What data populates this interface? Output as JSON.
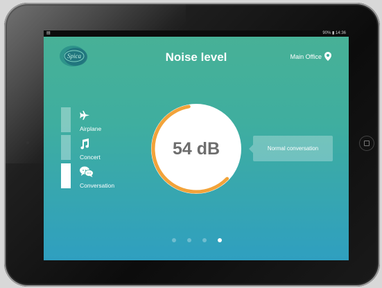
{
  "status_bar": {
    "right_text": "90% ▮ 14:36"
  },
  "header": {
    "title": "Noise level",
    "location": "Main Office",
    "logo_text": "Spica"
  },
  "categories": [
    {
      "label": "Airplane",
      "icon": "airplane-icon",
      "active": false
    },
    {
      "label": "Concert",
      "icon": "music-note-icon",
      "active": false
    },
    {
      "label": "Conversation",
      "icon": "chat-bubbles-icon",
      "active": true
    }
  ],
  "gauge": {
    "value_text": "54 dB",
    "fill_fraction": 0.6,
    "arc_color": "#f2a33a"
  },
  "description": "Normal conversation",
  "pager": {
    "pages": 4,
    "active_index": 3
  },
  "colors": {
    "bg_top": "#48b196",
    "bg_bottom": "#2f9fc0",
    "text": "#ffffff",
    "value_text": "#6d6d6d"
  }
}
